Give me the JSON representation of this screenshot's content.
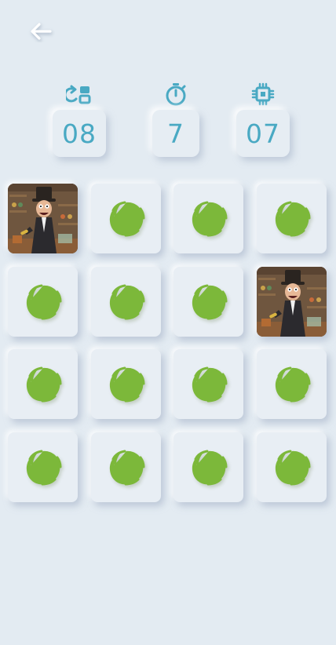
{
  "header": {
    "back_icon": "arrow-left-icon"
  },
  "stats": {
    "moves": {
      "icon": "swap-cards-icon",
      "value": "08"
    },
    "time": {
      "icon": "stopwatch-icon",
      "value": "7"
    },
    "pairs": {
      "icon": "chip-icon",
      "value": "07"
    }
  },
  "colors": {
    "background": "#e3ebf2",
    "accent": "#49a9c3",
    "portal": "#7cb83a"
  },
  "board": {
    "rows": 4,
    "cols": 4,
    "card_back_icon": "portal-swirl-icon",
    "flipped_card_image": "top-hat-character-illustration",
    "flipped": [
      [
        0,
        0
      ],
      [
        1,
        3
      ]
    ]
  }
}
